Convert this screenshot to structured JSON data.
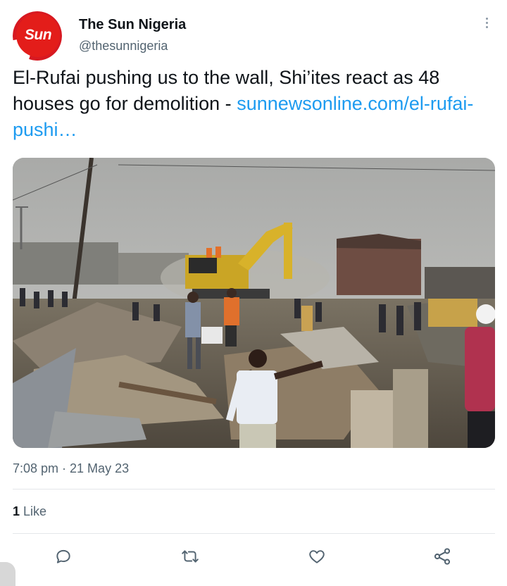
{
  "account": {
    "name": "The Sun Nigeria",
    "handle": "@thesunnigeria",
    "avatar_text": "Sun",
    "avatar_color": "#e31d1a"
  },
  "tweet": {
    "text": "El-Rufai pushing us to the wall, Shi’ites react as 48 houses go for demolition - ",
    "link": "sunnewsonline.com/el-rufai-pushi…",
    "link_color": "#1d9bf0"
  },
  "media": {
    "icon": "photo-demolition-scene"
  },
  "meta": {
    "timestamp": "7:08 pm · 21 May 23"
  },
  "stats": {
    "likes_count": "1",
    "likes_label": " Like"
  },
  "actions": {
    "reply_icon": "reply-icon",
    "retweet_icon": "retweet-icon",
    "like_icon": "heart-icon",
    "share_icon": "share-icon"
  }
}
